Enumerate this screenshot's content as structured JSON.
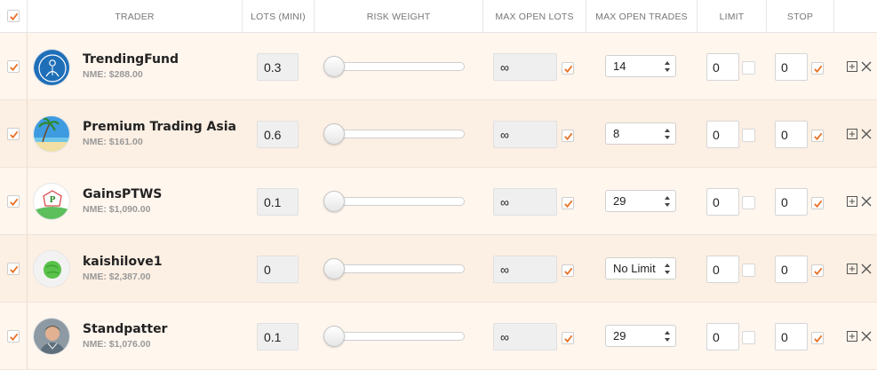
{
  "header": {
    "trader": "TRADER",
    "lots": "LOTS (MINI)",
    "risk_weight": "RISK WEIGHT",
    "max_open_lots": "MAX OPEN LOTS",
    "max_open_trades": "MAX OPEN TRADES",
    "limit": "LIMIT",
    "stop": "STOP"
  },
  "colors": {
    "accent": "#e8742a"
  },
  "rows": [
    {
      "name": "TrendingFund",
      "nme": "NME: $288.00",
      "lots": "0.3",
      "risk_weight": 0,
      "max_open_lots": "∞",
      "max_open_trades": "14",
      "limit": "0",
      "stop": "0",
      "avatar_icon": "trendingfund-avatar-icon"
    },
    {
      "name": "Premium Trading Asia",
      "nme": "NME: $161.00",
      "lots": "0.6",
      "risk_weight": 0,
      "max_open_lots": "∞",
      "max_open_trades": "8",
      "limit": "0",
      "stop": "0",
      "avatar_icon": "beach-avatar-icon"
    },
    {
      "name": "GainsPTWS",
      "nme": "NME: $1,090.00",
      "lots": "0.1",
      "risk_weight": 0,
      "max_open_lots": "∞",
      "max_open_trades": "29",
      "limit": "0",
      "stop": "0",
      "avatar_icon": "gainsptws-logo-icon"
    },
    {
      "name": "kaishilove1",
      "nme": "NME: $2,387.00",
      "lots": "0",
      "risk_weight": 0,
      "max_open_lots": "∞",
      "max_open_trades": "No Limit",
      "limit": "0",
      "stop": "0",
      "avatar_icon": "green-ball-avatar-icon"
    },
    {
      "name": "Standpatter",
      "nme": "NME: $1,076.00",
      "lots": "0.1",
      "risk_weight": 0,
      "max_open_lots": "∞",
      "max_open_trades": "29",
      "limit": "0",
      "stop": "0",
      "avatar_icon": "person-photo-avatar-icon"
    }
  ]
}
